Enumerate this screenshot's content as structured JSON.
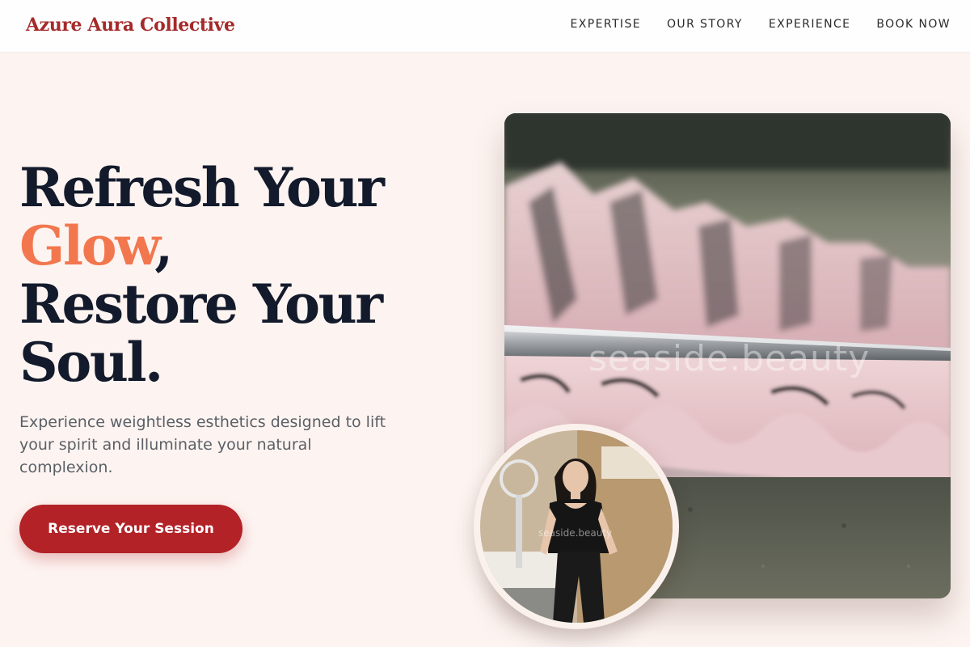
{
  "header": {
    "brand": "Azure Aura Collective",
    "nav": [
      {
        "label": "EXPERTISE"
      },
      {
        "label": "OUR STORY"
      },
      {
        "label": "EXPERIENCE"
      },
      {
        "label": "BOOK NOW"
      }
    ]
  },
  "hero": {
    "headline": {
      "line1": "Refresh Your",
      "accent_word": "Glow",
      "accent_suffix": ",",
      "line3": "Restore Your",
      "line4": "Soul."
    },
    "subcopy": "Experience weightless esthetics designed to lift your spirit and illuminate your natural complexion.",
    "cta_label": "Reserve Your Session",
    "image_watermark": "seaside.beauty",
    "portrait_watermark": "seaside.beauty"
  },
  "colors": {
    "brand": "#a52a2a",
    "accent": "#f2774e",
    "cta": "#b22227",
    "page_bg": "#fdf4f1",
    "heading": "#131a2b"
  },
  "icons": [
    "lash-tray-photo",
    "esthetician-portrait-photo"
  ]
}
